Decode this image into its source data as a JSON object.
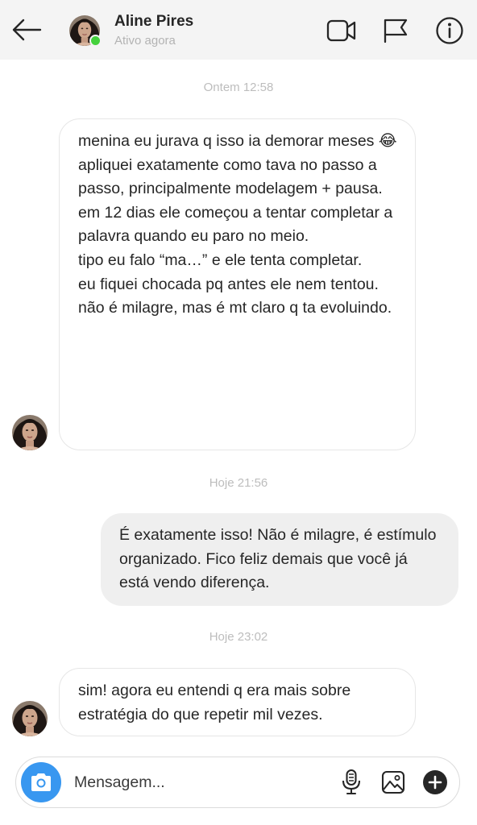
{
  "header": {
    "contact_name": "Aline Pires",
    "status": "Ativo agora"
  },
  "conversation": [
    {
      "timestamp": "Ontem 12:58",
      "message": {
        "sender": "contact",
        "text": "menina eu jurava q isso ia demorar meses 😂\napliquei exatamente como tava no passo a passo, principalmente modelagem + pausa.\nem 12 dias ele começou a tentar completar a palavra quando eu paro no meio.\ntipo eu falo “ma…” e ele tenta completar.\neu fiquei chocada pq antes ele nem tentou.\nnão é milagre, mas é mt claro q ta evoluindo."
      }
    },
    {
      "timestamp": "Hoje 21:56",
      "message": {
        "sender": "me",
        "text": "É exatamente isso! Não é milagre, é estímulo organizado. Fico feliz demais que você já está vendo diferença."
      }
    },
    {
      "timestamp": "Hoje 23:02",
      "message": {
        "sender": "contact",
        "text": "sim! agora eu entendi q era mais sobre estratégia do que repetir mil vezes."
      }
    }
  ],
  "composer": {
    "placeholder": "Mensagem..."
  },
  "icons": {
    "back": "arrow-left-icon",
    "video": "video-camera-icon",
    "flag": "flag-icon",
    "info": "info-icon",
    "camera": "camera-icon",
    "mic": "microphone-icon",
    "gallery": "image-icon",
    "plus": "plus-circle-icon"
  },
  "colors": {
    "header_bg": "#f4f4f4",
    "online": "#44d13c",
    "accent": "#3897f0",
    "outgoing_bubble": "#efefef",
    "timestamp": "#bdbdbd"
  }
}
